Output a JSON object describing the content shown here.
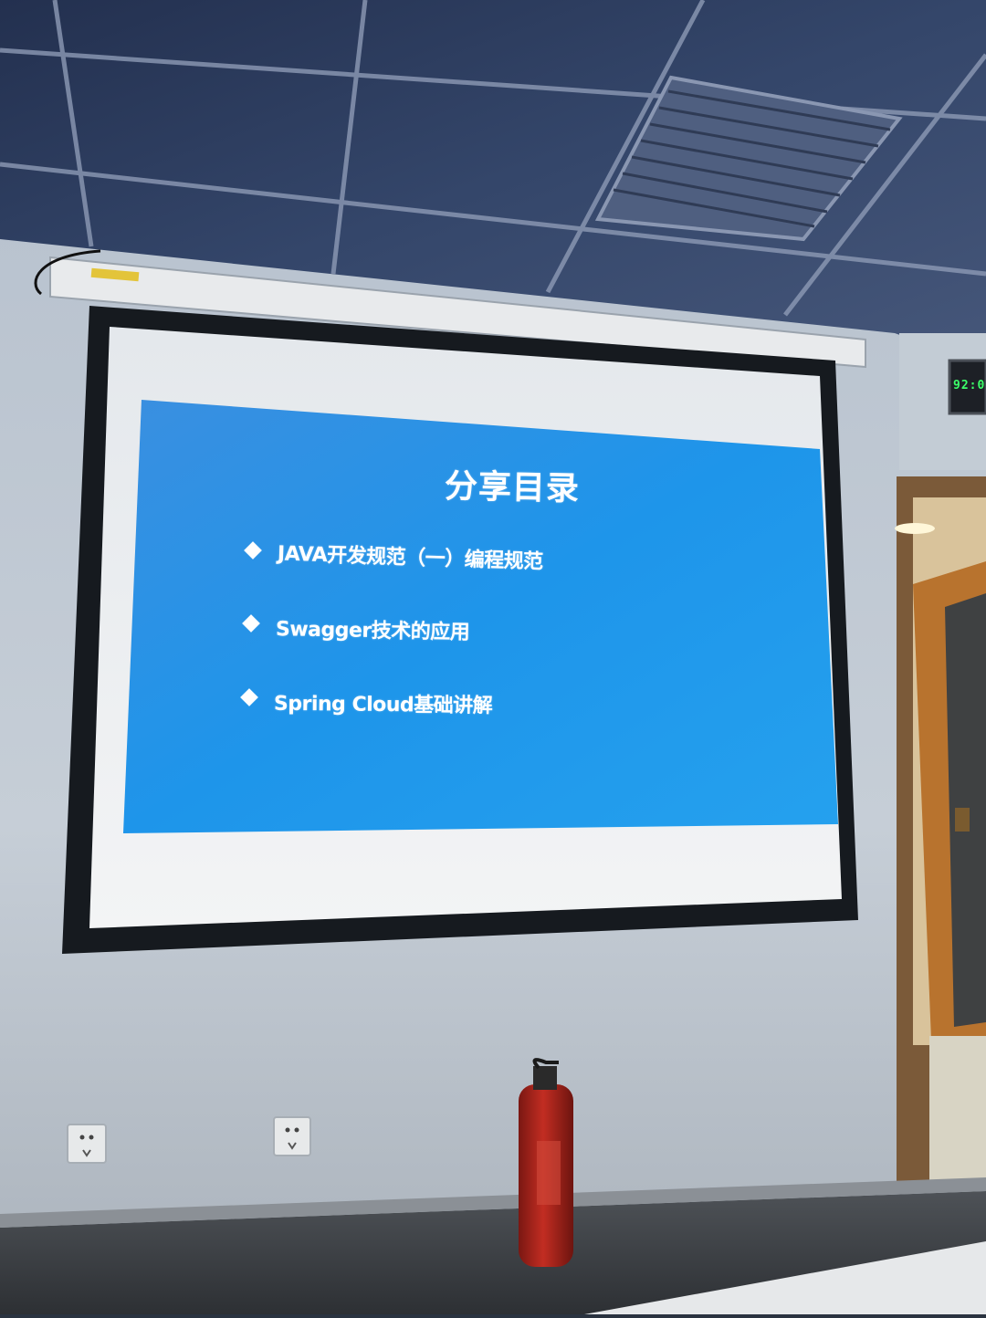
{
  "slide": {
    "title": "分享目录",
    "items": [
      "JAVA开发规范（一）编程规范",
      "Swagger技术的应用",
      "Spring Cloud基础讲解"
    ]
  },
  "wall_clock": {
    "text": "92:0"
  },
  "colors": {
    "slide_blue": "#2196e8",
    "screen_white": "#eef0f2",
    "screen_border": "#161a1f",
    "wall": "#c9d0d8",
    "ceiling": "#3d4a66",
    "door_frame": "#b8732e",
    "extinguisher_red": "#b3261e",
    "clock_green": "#3cff6a"
  }
}
